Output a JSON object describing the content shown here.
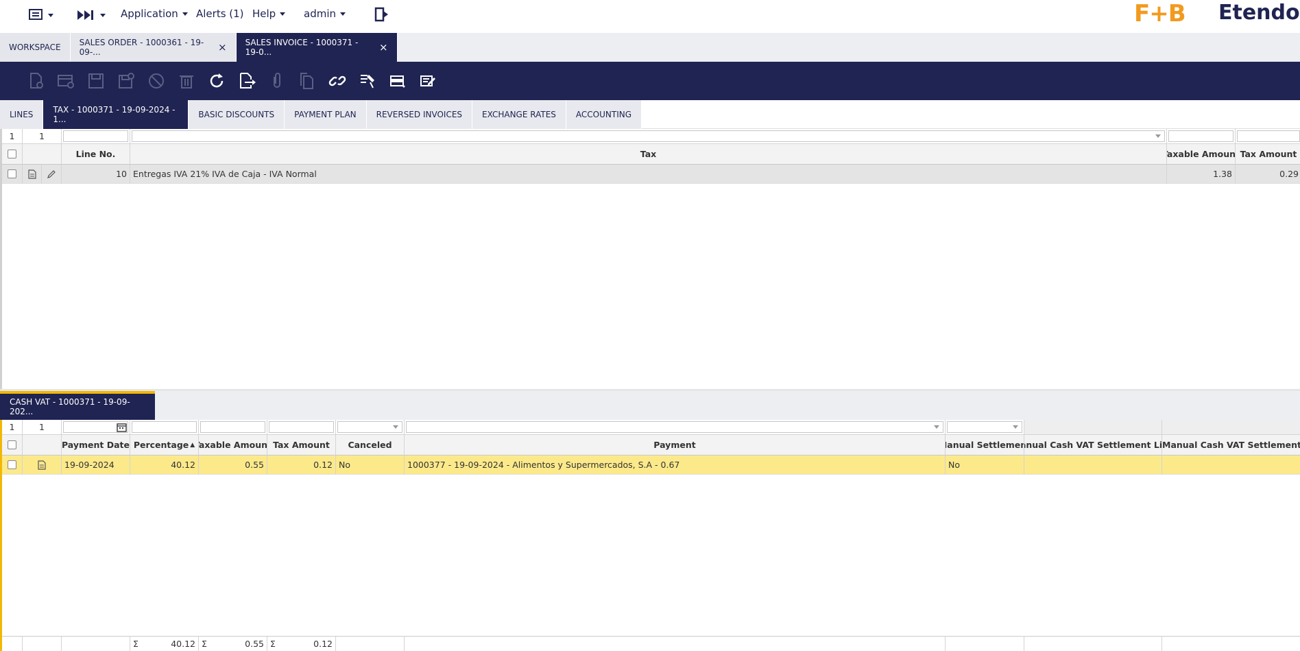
{
  "topbar": {
    "menus": [
      {
        "label": "Application"
      },
      {
        "label": "Alerts (1)"
      },
      {
        "label": "Help"
      },
      {
        "label": "admin"
      }
    ],
    "logo_fb": "F+B",
    "logo_etendo": "Etendo"
  },
  "window_tabs": [
    {
      "label": "WORKSPACE"
    },
    {
      "label": "SALES ORDER - 1000361 - 19-09-...",
      "close": "×"
    },
    {
      "label": "SALES INVOICE - 1000371 - 19-0...",
      "close": "×"
    }
  ],
  "toolbar": {
    "icons": [
      "new-document-icon",
      "new-row-icon",
      "save-icon",
      "save-close-icon",
      "undo-icon",
      "delete-icon",
      "refresh-icon",
      "export-icon",
      "attach-icon",
      "clone-icon",
      "link-icon",
      "tools-icon",
      "grid-view-icon",
      "notes-icon"
    ]
  },
  "sub_tabs": [
    {
      "label": "LINES"
    },
    {
      "label": "TAX - 1000371 - 19-09-2024 - 1..."
    },
    {
      "label": "BASIC DISCOUNTS"
    },
    {
      "label": "PAYMENT PLAN"
    },
    {
      "label": "REVERSED INVOICES"
    },
    {
      "label": "EXCHANGE RATES"
    },
    {
      "label": "ACCOUNTING"
    }
  ],
  "tax_grid": {
    "counter_a": "1",
    "counter_b": "1",
    "headers": {
      "line_no": "Line No.",
      "tax": "Tax",
      "taxable_amount": "Taxable Amount",
      "tax_amount": "Tax Amount"
    },
    "rows": [
      {
        "line_no": "10",
        "tax": "Entregas IVA 21% IVA de Caja - IVA Normal",
        "taxable_amount": "1.38",
        "tax_amount": "0.29"
      }
    ]
  },
  "cash_vat_tab": {
    "label": "CASH VAT - 1000371 - 19-09-202..."
  },
  "cash_grid": {
    "counter_a": "1",
    "counter_b": "1",
    "headers": {
      "payment_date": "Payment Date",
      "percentage": "Percentage",
      "sort_indicator": "▲",
      "taxable_amount": "Taxable Amount",
      "tax_amount": "Tax Amount",
      "canceled": "Canceled",
      "payment": "Payment",
      "manual_settlement": "Manual Settlement",
      "manual_line": "Manual Cash VAT Settlement Line",
      "manual_date": "Manual Cash VAT Settlement Date"
    },
    "rows": [
      {
        "payment_date": "19-09-2024",
        "percentage": "40.12",
        "taxable_amount": "0.55",
        "tax_amount": "0.12",
        "canceled": "No",
        "payment": "1000377 - 19-09-2024 - Alimentos y Supermercados, S.A - 0.67",
        "manual_settlement": "No"
      }
    ],
    "summary": {
      "sigma": "Σ",
      "percentage": "40.12",
      "taxable_amount": "0.55",
      "tax_amount": "0.12"
    }
  },
  "colors": {
    "brand": "#202452",
    "accent": "#f2b705",
    "selected_row": "#fce98a"
  }
}
